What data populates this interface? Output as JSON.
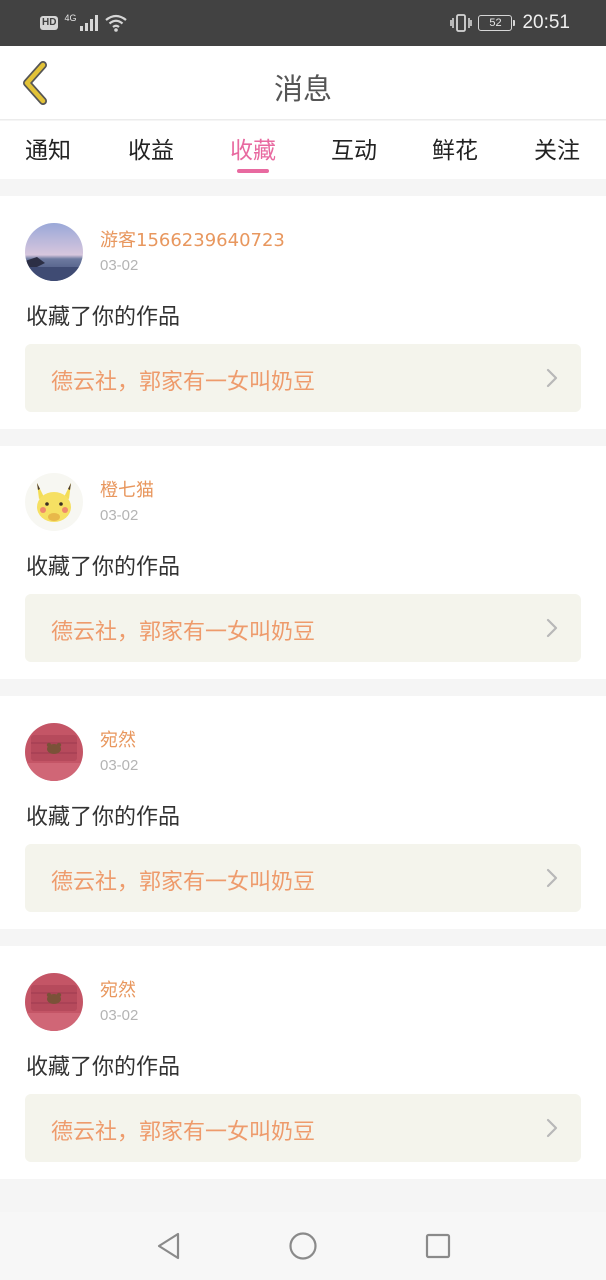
{
  "status_bar": {
    "left_badge": "HD",
    "network": "4G",
    "battery": "52",
    "time": "20:51",
    "icons": [
      "signal-icon",
      "wifi-icon",
      "vibrate-icon",
      "battery-icon"
    ]
  },
  "header": {
    "title": "消息",
    "back_icon": "chevron-left-icon"
  },
  "tabs": [
    {
      "label": "通知"
    },
    {
      "label": "收益"
    },
    {
      "label": "收藏",
      "active": true
    },
    {
      "label": "互动"
    },
    {
      "label": "鲜花"
    },
    {
      "label": "关注"
    }
  ],
  "notifications": [
    {
      "user": "游客1566239640723",
      "date": "03-02",
      "action": "收藏了你的作品",
      "work_title": "德云社，郭家有一女叫奶豆",
      "avatar": "sunset-photo"
    },
    {
      "user": "橙七猫",
      "date": "03-02",
      "action": "收藏了你的作品",
      "work_title": "德云社，郭家有一女叫奶豆",
      "avatar": "pikachu-photo"
    },
    {
      "user": "宛然",
      "date": "03-02",
      "action": "收藏了你的作品",
      "work_title": "德云社，郭家有一女叫奶豆",
      "avatar": "red-bear-photo"
    },
    {
      "user": "宛然",
      "date": "03-02",
      "action": "收藏了你的作品",
      "work_title": "德云社，郭家有一女叫奶豆",
      "avatar": "red-bear-photo"
    }
  ],
  "colors": {
    "accent": "#e86aa0",
    "username": "#e8975e",
    "work_title": "#ee9b6c",
    "work_box_bg": "#f4f4ec",
    "status_bar_bg": "#424242",
    "back_icon": "#c9a227"
  },
  "system_nav": {
    "icons": [
      "back-triangle-icon",
      "home-circle-icon",
      "recents-square-icon"
    ]
  }
}
